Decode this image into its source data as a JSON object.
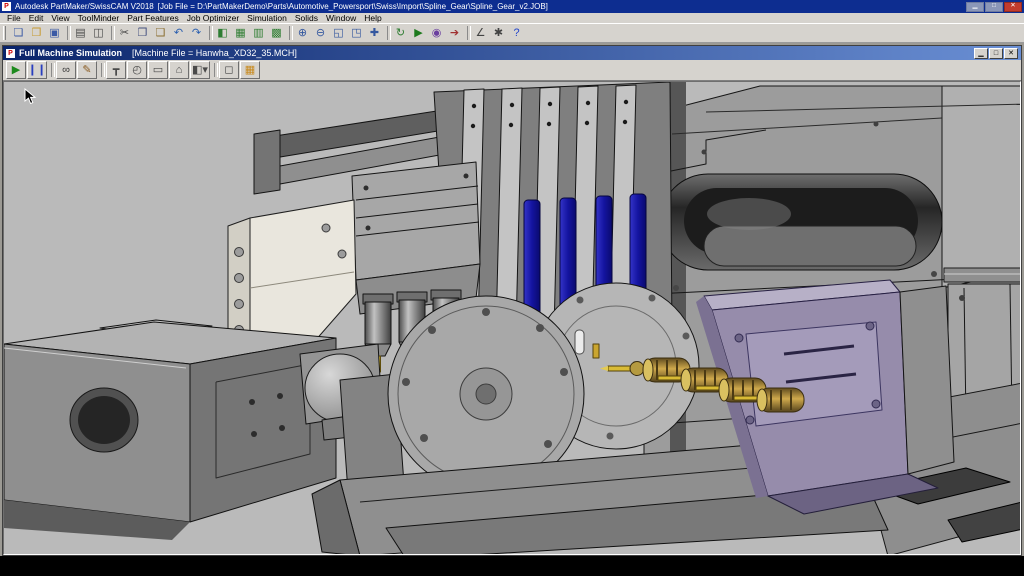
{
  "colors": {
    "titlebar-blue": "#0d2d90",
    "child-titlebar-from": "#0a246a",
    "child-titlebar-to": "#6a8fd4",
    "toolbar-bg": "#d6d3ce",
    "viewport-bg": "#bababa",
    "tool-blue": "#1a1ab4",
    "tool-gold": "#c9a84e",
    "attachment-purple": "#968cab",
    "close-red": "#c23b2e"
  },
  "title_bar": {
    "app_initial": "P",
    "app_title": "Autodesk PartMaker/SwissCAM V2018",
    "job_file": "[Job File = D:\\PartMakerDemo\\Parts\\Automotive_Powersport\\Swiss\\Import\\Spline_Gear\\Spline_Gear_v2.JOB]",
    "buttons": {
      "minimize": "▁",
      "maximize": "□",
      "close": "✕"
    }
  },
  "menu_bar": {
    "items": [
      "File",
      "Edit",
      "View",
      "ToolMinder",
      "Part Features",
      "Job Optimizer",
      "Simulation",
      "Solids",
      "Window",
      "Help"
    ]
  },
  "toolbar": {
    "icons": [
      {
        "name": "new-document-icon",
        "glyph": "❏",
        "color": "#3b5aa5"
      },
      {
        "name": "open-folder-icon",
        "glyph": "❒",
        "color": "#c79a2e"
      },
      {
        "name": "save-icon",
        "glyph": "▣",
        "color": "#3b5aa5"
      },
      {
        "name": "separator",
        "sep": "true",
        "inter": "false"
      },
      {
        "name": "print-icon",
        "glyph": "▤",
        "color": "#4a4a4a"
      },
      {
        "name": "print-preview-icon",
        "glyph": "◫",
        "color": "#4a4a4a"
      },
      {
        "name": "separator",
        "sep": "true",
        "inter": "false"
      },
      {
        "name": "cut-icon",
        "glyph": "✂",
        "color": "#434343"
      },
      {
        "name": "copy-icon",
        "glyph": "❐",
        "color": "#44507f"
      },
      {
        "name": "paste-icon",
        "glyph": "❑",
        "color": "#8a6d2f"
      },
      {
        "name": "undo-icon",
        "glyph": "↶",
        "color": "#2a5fb0"
      },
      {
        "name": "redo-icon",
        "glyph": "↷",
        "color": "#2a5fb0"
      },
      {
        "name": "separator",
        "sep": "true",
        "inter": "false"
      },
      {
        "name": "part-features-window-icon",
        "glyph": "◧",
        "color": "#2e7d32"
      },
      {
        "name": "tools-window-icon",
        "glyph": "▦",
        "color": "#2e7d32"
      },
      {
        "name": "process-table-icon",
        "glyph": "▥",
        "color": "#2e7d32"
      },
      {
        "name": "job-optimizer-icon",
        "glyph": "▩",
        "color": "#2e7d32"
      },
      {
        "name": "separator",
        "sep": "true",
        "inter": "false"
      },
      {
        "name": "zoom-in-icon",
        "glyph": "⊕",
        "color": "#33579f"
      },
      {
        "name": "zoom-out-icon",
        "glyph": "⊖",
        "color": "#33579f"
      },
      {
        "name": "zoom-window-icon",
        "glyph": "◱",
        "color": "#33579f"
      },
      {
        "name": "zoom-fit-icon",
        "glyph": "◳",
        "color": "#33579f"
      },
      {
        "name": "pan-icon",
        "glyph": "✚",
        "color": "#33579f"
      },
      {
        "name": "separator",
        "sep": "true",
        "inter": "false"
      },
      {
        "name": "redraw-icon",
        "glyph": "↻",
        "color": "#2e7d32"
      },
      {
        "name": "simulation-icon",
        "glyph": "▶",
        "color": "#1d7a1d"
      },
      {
        "name": "verify-icon",
        "glyph": "◉",
        "color": "#6a3f9f"
      },
      {
        "name": "post-process-icon",
        "glyph": "➔",
        "color": "#a03030"
      },
      {
        "name": "separator",
        "sep": "true",
        "inter": "false"
      },
      {
        "name": "measure-icon",
        "glyph": "∠",
        "color": "#434343"
      },
      {
        "name": "options-icon",
        "glyph": "✱",
        "color": "#434343"
      },
      {
        "name": "help-icon",
        "glyph": "?",
        "color": "#2244cc"
      }
    ]
  },
  "sim_window": {
    "icon_initial": "P",
    "title": "Full Machine Simulation",
    "machine_file": "[Machine File = Hanwha_XD32_35.MCH]",
    "buttons": {
      "minimize": "▁",
      "maximize": "□",
      "close": "✕"
    },
    "toolbar_icons": [
      {
        "name": "play-button",
        "glyph": "▶",
        "color": "#1d8a1d"
      },
      {
        "name": "pause-button",
        "glyph": "❙❙",
        "color": "#2a3fbf"
      },
      {
        "name": "separator",
        "sep": "true",
        "inter": "false"
      },
      {
        "name": "verify-glasses-icon",
        "glyph": "∞",
        "color": "#3a3a3a"
      },
      {
        "name": "edit-pencil-icon",
        "glyph": "✎",
        "color": "#8a5a1f"
      },
      {
        "name": "separator",
        "sep": "true",
        "inter": "false"
      },
      {
        "name": "tool-display-icon",
        "glyph": "┳",
        "color": "#4a4a4a"
      },
      {
        "name": "turret-display-icon",
        "glyph": "◴",
        "color": "#4a4a4a"
      },
      {
        "name": "stock-display-icon",
        "glyph": "▭",
        "color": "#4a4a4a"
      },
      {
        "name": "machine-display-icon",
        "glyph": "⌂",
        "color": "#4a4a4a"
      },
      {
        "name": "view-mode-dropdown",
        "glyph": "◧▾",
        "color": "#4a4a4a"
      },
      {
        "name": "separator",
        "sep": "true",
        "inter": "false"
      },
      {
        "name": "single-block-icon",
        "glyph": "◻",
        "color": "#4a4a4a"
      },
      {
        "name": "report-icon",
        "glyph": "▦",
        "color": "#c8881a"
      }
    ]
  }
}
